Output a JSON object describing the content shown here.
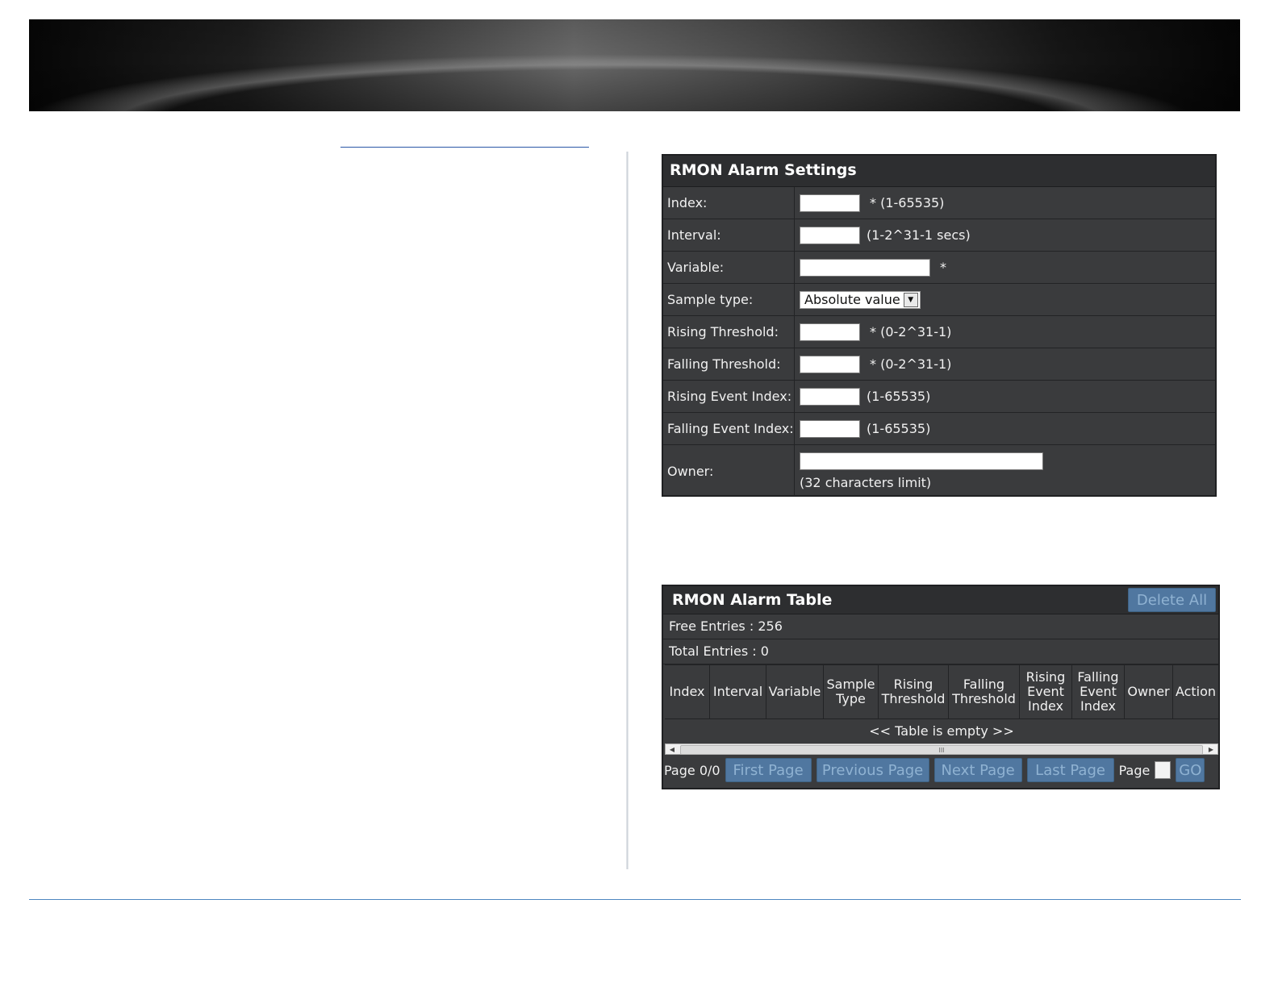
{
  "settings": {
    "title": "RMON Alarm Settings",
    "rows": [
      {
        "label": "Index:",
        "hint": "* (1-65535)"
      },
      {
        "label": "Interval:",
        "hint": "(1-2^31-1 secs)"
      },
      {
        "label": "Variable:",
        "hint": "*"
      },
      {
        "label": "Sample type:",
        "select_value": "Absolute value"
      },
      {
        "label": "Rising Threshold:",
        "hint": "* (0-2^31-1)"
      },
      {
        "label": "Falling Threshold:",
        "hint": "* (0-2^31-1)"
      },
      {
        "label": "Rising Event Index:",
        "hint": "(1-65535)"
      },
      {
        "label": "Falling Event Index:",
        "hint": "(1-65535)"
      },
      {
        "label": "Owner:",
        "hint": "(32 characters limit)"
      }
    ]
  },
  "table": {
    "title": "RMON Alarm Table",
    "delete_all": "Delete All",
    "free_entries": "Free Entries : 256",
    "total_entries": "Total Entries : 0",
    "headers": [
      "Index",
      "Interval",
      "Variable",
      "Sample Type",
      "Rising Threshold",
      "Falling Threshold",
      "Rising Event Index",
      "Falling Event Index",
      "Owner",
      "Action"
    ],
    "empty_text": "<< Table is empty >>",
    "scroll_thumb_glyph": "III"
  },
  "pager": {
    "page_status": "Page 0/0",
    "first": "First Page",
    "previous": "Previous Page",
    "next": "Next Page",
    "last": "Last Page",
    "page_label": "Page",
    "go": "GO"
  },
  "colors": {
    "panel_bg": "#3a3b3d",
    "title_bg": "#2d2e30",
    "button_bg": "#5077a0",
    "button_text": "#8fb2d2",
    "rule_blue": "#4e86c0"
  }
}
